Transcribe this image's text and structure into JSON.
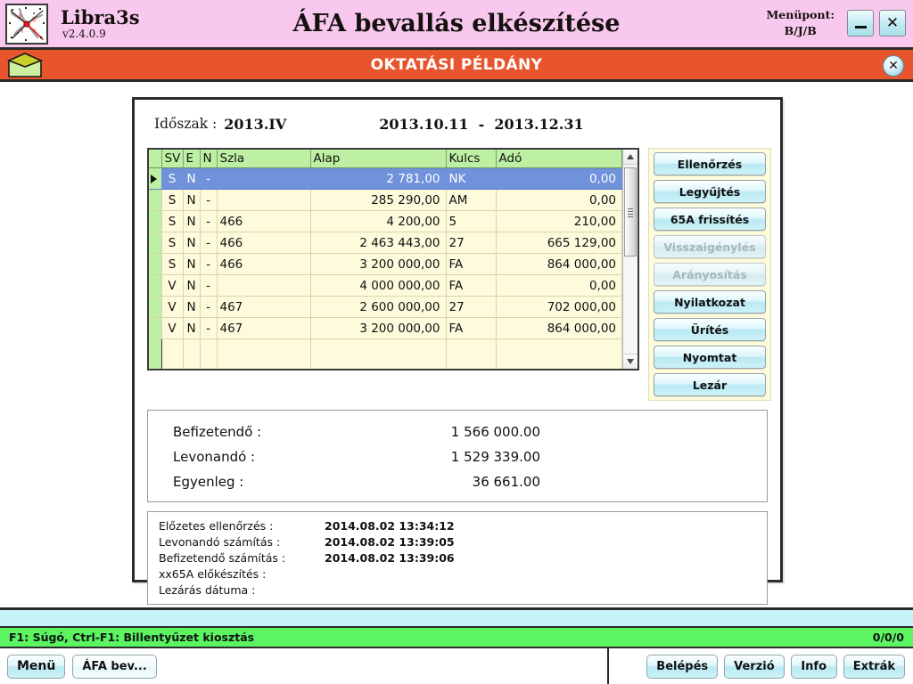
{
  "titlebar": {
    "brand_name": "Libra3s",
    "brand_version": "v2.4.0.9",
    "app_title": "ÁFA bevallás elkészítése",
    "menupoint_label": "Menüpont:",
    "menupoint_value": "B/J/B",
    "minimize_label": "",
    "close_label": "✕"
  },
  "banner": {
    "text": "OKTATÁSI PÉLDÁNY",
    "close_label": "✕",
    "bg_color": "#e8552d"
  },
  "period": {
    "label": "Időszak :",
    "value": "2013.IV",
    "range": "2013.10.11  -  2013.12.31"
  },
  "grid": {
    "columns": [
      "SV",
      "E",
      "N",
      "Szla",
      "Alap",
      "Kulcs",
      "Adó"
    ],
    "selected_index": 0,
    "rows": [
      {
        "sv": "S",
        "e": "N",
        "n": "-",
        "szla": "",
        "alap": "2 781,00",
        "kulcs": "NK",
        "ado": "0,00"
      },
      {
        "sv": "S",
        "e": "N",
        "n": "-",
        "szla": "",
        "alap": "285 290,00",
        "kulcs": "AM",
        "ado": "0,00"
      },
      {
        "sv": "S",
        "e": "N",
        "n": "-",
        "szla": "466",
        "alap": "4 200,00",
        "kulcs": "5",
        "ado": "210,00"
      },
      {
        "sv": "S",
        "e": "N",
        "n": "-",
        "szla": "466",
        "alap": "2 463 443,00",
        "kulcs": "27",
        "ado": "665 129,00"
      },
      {
        "sv": "S",
        "e": "N",
        "n": "-",
        "szla": "466",
        "alap": "3 200 000,00",
        "kulcs": "FA",
        "ado": "864 000,00"
      },
      {
        "sv": "V",
        "e": "N",
        "n": "-",
        "szla": "",
        "alap": "4 000 000,00",
        "kulcs": "FA",
        "ado": "0,00"
      },
      {
        "sv": "V",
        "e": "N",
        "n": "-",
        "szla": "467",
        "alap": "2 600 000,00",
        "kulcs": "27",
        "ado": "702 000,00"
      },
      {
        "sv": "V",
        "e": "N",
        "n": "-",
        "szla": "467",
        "alap": "3 200 000,00",
        "kulcs": "FA",
        "ado": "864 000,00"
      }
    ]
  },
  "side_buttons": [
    {
      "label": "Ellenőrzés",
      "disabled": false
    },
    {
      "label": "Legyűjtés",
      "disabled": false
    },
    {
      "label": "65A frissítés",
      "disabled": false
    },
    {
      "label": "Visszaigénylés",
      "disabled": true
    },
    {
      "label": "Arányosítás",
      "disabled": true
    },
    {
      "label": "Nyilatkozat",
      "disabled": false
    },
    {
      "label": "Ürítés",
      "disabled": false
    },
    {
      "label": "Nyomtat",
      "disabled": false
    },
    {
      "label": "Lezár",
      "disabled": false
    }
  ],
  "totals": [
    {
      "label": "Befizetendő :",
      "value": "1 566 000.00"
    },
    {
      "label": "Levonandó :",
      "value": "1 529 339.00"
    },
    {
      "label": "Egyenleg :",
      "value": "36 661.00"
    }
  ],
  "log": [
    {
      "label": "Előzetes ellenőrzés :",
      "value": "2014.08.02 13:34:12"
    },
    {
      "label": "Levonandó számítás :",
      "value": "2014.08.02 13:39:05"
    },
    {
      "label": "Befizetendő számítás :",
      "value": "2014.08.02 13:39:06"
    },
    {
      "label": "xx65A előkészítés :",
      "value": ""
    },
    {
      "label": "Lezárás dátuma :",
      "value": ""
    }
  ],
  "statusbar": {
    "hint": "F1: Súgó, Ctrl-F1: Billentyűzet kiosztás",
    "counter": "0/0/0"
  },
  "bottombar": {
    "left_buttons": [
      {
        "label": "Menü"
      },
      {
        "label": "ÁFA bev..."
      }
    ],
    "right_buttons": [
      {
        "label": "Belépés"
      },
      {
        "label": "Verzió"
      },
      {
        "label": "Info"
      },
      {
        "label": "Extrák"
      }
    ]
  }
}
